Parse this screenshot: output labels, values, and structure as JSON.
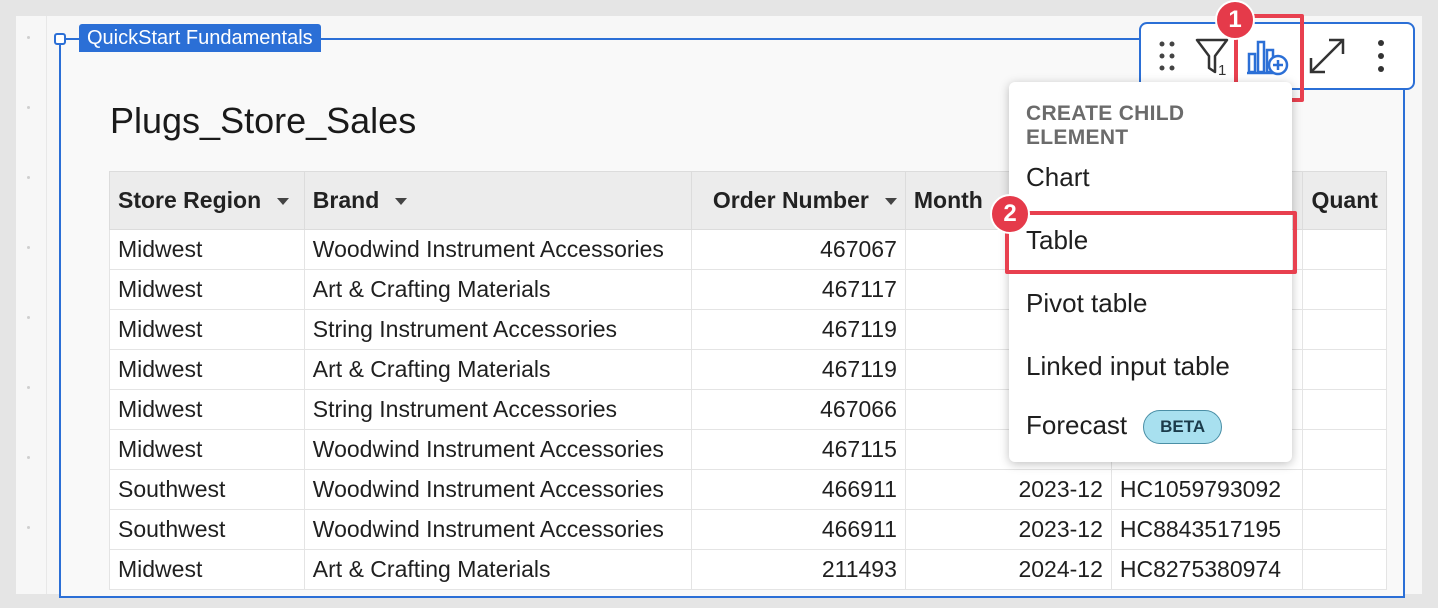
{
  "element_tag": "QuickStart Fundamentals",
  "page_title": "Plugs_Store_Sales",
  "table": {
    "columns": [
      "Store Region",
      "Brand",
      "Order Number",
      "Month",
      "",
      "Quant"
    ],
    "rows": [
      [
        "Midwest",
        "Woodwind Instrument Accessories",
        "467067",
        "",
        "",
        ""
      ],
      [
        "Midwest",
        "Art & Crafting Materials",
        "467117",
        "",
        "",
        ""
      ],
      [
        "Midwest",
        "String Instrument Accessories",
        "467119",
        "",
        "",
        ""
      ],
      [
        "Midwest",
        "Art & Crafting Materials",
        "467119",
        "",
        "",
        ""
      ],
      [
        "Midwest",
        "String Instrument Accessories",
        "467066",
        "",
        "",
        ""
      ],
      [
        "Midwest",
        "Woodwind Instrument Accessories",
        "467115",
        "",
        "",
        ""
      ],
      [
        "Southwest",
        "Woodwind Instrument Accessories",
        "466911",
        "2023-12",
        "HC1059793092",
        ""
      ],
      [
        "Southwest",
        "Woodwind Instrument Accessories",
        "466911",
        "2023-12",
        "HC8843517195",
        ""
      ],
      [
        "Midwest",
        "Art & Crafting Materials",
        "211493",
        "2024-12",
        "HC8275380974",
        ""
      ]
    ]
  },
  "toolbar": {
    "filter_count": "1",
    "icons": [
      "drag-handle-icon",
      "filter-icon",
      "add-child-element-icon",
      "expand-icon",
      "more-options-icon"
    ]
  },
  "badges": {
    "step1": "1",
    "step2": "2"
  },
  "menu": {
    "header": "CREATE CHILD ELEMENT",
    "items": [
      "Chart",
      "Table",
      "Pivot table",
      "Linked input table",
      "Forecast"
    ],
    "beta_label": "BETA"
  },
  "colors": {
    "accent": "#2b6fd6",
    "highlight": "#e8404f",
    "beta_bg": "#a8e0ef"
  }
}
